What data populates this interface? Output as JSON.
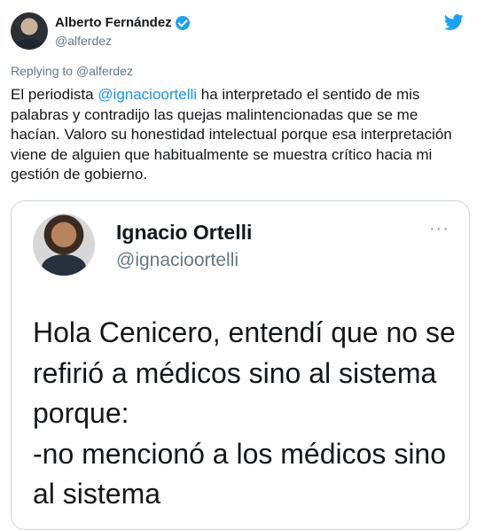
{
  "author": {
    "display_name": "Alberto Fernández",
    "handle": "@alferdez",
    "verified_icon": "verified-badge-icon"
  },
  "platform_icon": "twitter-bird-icon",
  "replying": {
    "prefix": "Replying to ",
    "mention": "@alferdez"
  },
  "body": {
    "before_mention": "El periodista ",
    "mention": "@ignacioortelli",
    "after_mention": " ha interpretado el sentido de mis palabras y contradijo las quejas malintencionadas que se me hacían. Valoro su honestidad intelectual porque esa interpretación viene de alguien que habitualmente se muestra crítico hacia mi gestión de gobierno."
  },
  "quoted": {
    "display_name": "Ignacio Ortelli",
    "handle": "@ignacioortelli",
    "more_icon": "more-options-icon",
    "more_label": "···",
    "text": "Hola Cenicero, entendí que no se refirió a médicos sino al sistema porque:\n-no mencionó a los médicos sino al sistema"
  },
  "colors": {
    "link": "#1b95e0",
    "twitter_blue": "#1da1f2",
    "secondary_text": "#657786"
  }
}
